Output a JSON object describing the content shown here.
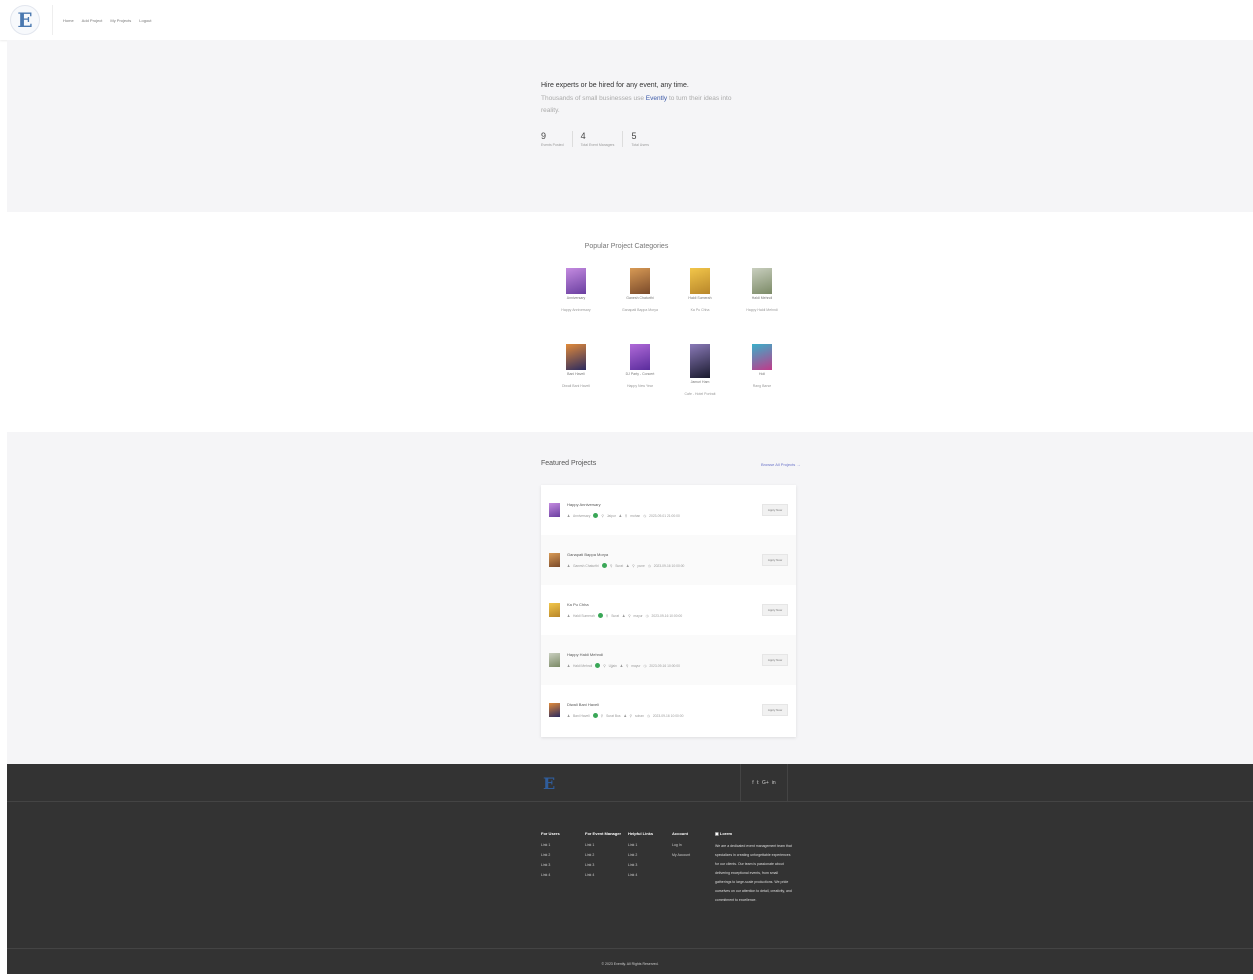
{
  "nav": {
    "logo_label": "E",
    "links": [
      "Home",
      "Add Project",
      "My Projects",
      "Logout"
    ]
  },
  "hero": {
    "title": "Hire experts or be hired for any event, any time.",
    "sub_prefix": "Thousands of small businesses use",
    "brand": "Evently",
    "sub_suffix": "to turn their ideas into reality.",
    "stats": [
      {
        "value": "9",
        "label": "Events Posted"
      },
      {
        "value": "4",
        "label": "Total Event Managers"
      },
      {
        "value": "5",
        "label": "Total Users"
      }
    ]
  },
  "categories": {
    "title": "Popular Project Categories",
    "items": [
      {
        "name": "Anniversary",
        "event": "Happy Anniversary",
        "color1": "#6a3fa0",
        "color2": "#c48be0"
      },
      {
        "name": "Ganesh Chaturthi",
        "event": "Ganapati Bappa Morya",
        "color1": "#7a4a2a",
        "color2": "#d89a55"
      },
      {
        "name": "Haldi Sumerah",
        "event": "Ka Pu Chha",
        "color1": "#b8862a",
        "color2": "#f2c64a"
      },
      {
        "name": "Haldi Mehndi",
        "event": "Happy Haldi Mehndi",
        "color1": "#7b8a66",
        "color2": "#c9cfbf"
      },
      {
        "name": "Bani Haveli",
        "event": "Diwali Bani Haveli",
        "color1": "#2a2a60",
        "color2": "#e08a3a"
      },
      {
        "name": "DJ Party - Concert",
        "event": "Happy New Year",
        "color1": "#5a2c9c",
        "color2": "#b06ad8"
      },
      {
        "name": "Jamuri Ham",
        "event": "Cafe - Hotel Portrait",
        "color1": "#1a1a2e",
        "color2": "#8a7ab8"
      },
      {
        "name": "Holi",
        "event": "Rang Barse",
        "color1": "#c03a8a",
        "color2": "#3ab0c9"
      }
    ]
  },
  "featured": {
    "title": "Featured Projects",
    "browse_label": "Browse All Projects →",
    "apply_label": "Apply Now",
    "projects": [
      {
        "title": "Happy Anniversary",
        "manager": "Anniversary",
        "city": "Jaipur",
        "venue": "mohan",
        "date": "2023-09-01 21:00:00",
        "color1": "#6a3fa0",
        "color2": "#c48be0"
      },
      {
        "title": "Ganapati Bappa Morya",
        "manager": "Ganesh Chaturthi",
        "city": "Surat",
        "venue": "pune",
        "date": "2023-09-16 10:00:00",
        "color1": "#7a4a2a",
        "color2": "#d89a55"
      },
      {
        "title": "Ka Pu Chha",
        "manager": "Haldi Sumerah",
        "city": "Surat",
        "venue": "mayur",
        "date": "2023-09-16 10:00:00",
        "color1": "#b8862a",
        "color2": "#f2c64a"
      },
      {
        "title": "Happy Haldi Mehndi",
        "manager": "Haldi Mehndi",
        "city": "Ujjain",
        "venue": "mayur",
        "date": "2023-09-16 10:00:00",
        "color1": "#7b8a66",
        "color2": "#c9cfbf"
      },
      {
        "title": "Diwali Bani Haveli",
        "manager": "Bani Haveli",
        "city": "Surat Bus",
        "venue": "sohan",
        "date": "2023-09-16 10:00:00",
        "color1": "#2a2a60",
        "color2": "#e08a3a"
      }
    ]
  },
  "footer": {
    "logo": "E",
    "social": [
      "f",
      "𝕥",
      "G+",
      "in"
    ],
    "columns": [
      {
        "title": "For Users",
        "links": [
          "Link 1",
          "Link 2",
          "Link 3",
          "Link 4"
        ]
      },
      {
        "title": "For Event Manager",
        "links": [
          "Link 1",
          "Link 2",
          "Link 3",
          "Link 4"
        ]
      },
      {
        "title": "Helpful Links",
        "links": [
          "Link 1",
          "Link 2",
          "Link 3",
          "Link 4"
        ]
      },
      {
        "title": "Account",
        "links": [
          "Log In",
          "My Account"
        ]
      }
    ],
    "about_title": "Lorem",
    "about_text": "We are a dedicated event management team that specializes in creating unforgettable experiences for our clients. Our team is passionate about delivering exceptional events, from small gatherings to large-scale productions. We pride ourselves on our attention to detail, creativity, and commitment to excellence.",
    "copyright": "© 2023 Evently. All Rights Reserved."
  }
}
